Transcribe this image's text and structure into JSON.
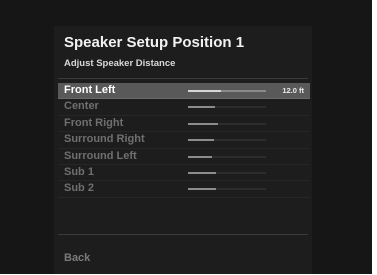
{
  "header": {
    "title": "Speaker Setup Position 1",
    "subtitle": "Adjust Speaker Distance"
  },
  "speakers": [
    {
      "label": "Front Left",
      "value": "12.0 ft",
      "level": 0.42,
      "selected": true
    },
    {
      "label": "Center",
      "value": "",
      "level": 0.35,
      "selected": false
    },
    {
      "label": "Front Right",
      "value": "",
      "level": 0.38,
      "selected": false
    },
    {
      "label": "Surround Right",
      "value": "",
      "level": 0.33,
      "selected": false
    },
    {
      "label": "Surround Left",
      "value": "",
      "level": 0.31,
      "selected": false
    },
    {
      "label": "Sub 1",
      "value": "",
      "level": 0.36,
      "selected": false
    },
    {
      "label": "Sub 2",
      "value": "",
      "level": 0.36,
      "selected": false
    }
  ],
  "footer": {
    "back_label": "Back"
  }
}
